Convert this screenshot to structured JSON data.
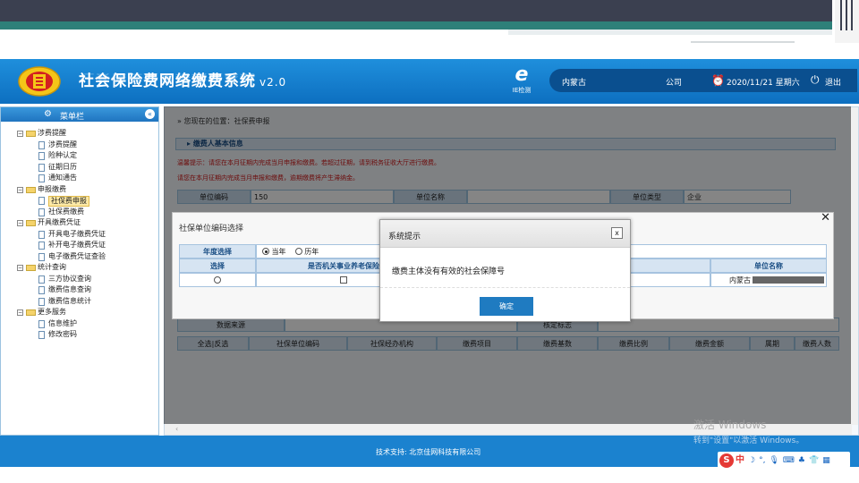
{
  "app": {
    "title": "社会保险费网络缴费系统",
    "version": "v2.0",
    "ie_check_label": "IE检测",
    "region": "内蒙古",
    "company": "公司",
    "datetime": "2020/11/21 星期六",
    "logout": "退出"
  },
  "sidebar": {
    "title": "菜单栏",
    "collapse_glyph": "«",
    "groups": [
      {
        "label": "涉费提醒",
        "items": [
          "涉费提醒",
          "险种认定",
          "征期日历",
          "通知通告"
        ]
      },
      {
        "label": "申报缴费",
        "items": [
          "社保费申报",
          "社保费缴费"
        ]
      },
      {
        "label": "开具缴费凭证",
        "items": [
          "开具电子缴费凭证",
          "补开电子缴费凭证",
          "电子缴费凭证查验"
        ]
      },
      {
        "label": "统计查询",
        "items": [
          "三方协议查询",
          "缴费信息查询",
          "缴费信息统计"
        ]
      },
      {
        "label": "更多服务",
        "items": [
          "信息维护",
          "修改密码"
        ]
      }
    ],
    "active_item": "社保费申报"
  },
  "main": {
    "breadcrumb": "您现在的位置：社保费申报",
    "section_title": "缴费人基本信息",
    "warn1": "温馨提示：请您在本月征期内完成当月申报和缴费。若超过征期，请到税务征收大厅进行缴费。",
    "warn2": "请您在本月征期内完成当月申报和缴费，逾期缴费将产生滞纳金。",
    "form": {
      "unit_code_label": "单位编码",
      "unit_code_value": "150",
      "unit_name_label": "单位名称",
      "unit_type_label": "单位类型",
      "unit_type_value": "企业"
    },
    "lower": {
      "data_source_label": "数据来源",
      "verify_label": "核定标志",
      "columns": [
        "全选|反选",
        "社保单位编码",
        "社保经办机构",
        "缴费项目",
        "缴费基数",
        "缴费比例",
        "缴费金额",
        "属期",
        "缴费人数"
      ]
    }
  },
  "selector_panel": {
    "title": "社保单位编码选择",
    "close_glyph": "✕",
    "year_label": "年度选择",
    "year_current": "当年",
    "year_history": "历年",
    "columns": {
      "select": "选择",
      "is_public": "是否机关事业养老保险",
      "unit_name": "单位名称"
    },
    "row_unit_name": "内蒙古"
  },
  "dialog": {
    "title": "系统提示",
    "close_glyph": "x",
    "message": "缴费主体没有有效的社会保障号",
    "ok": "确定"
  },
  "footer": {
    "support": "技术支持: 北京佳网科技有限公司"
  },
  "os": {
    "watermark_line1": "激活 Windows",
    "watermark_line2": "转到\"设置\"以激活 Windows。",
    "ime_mode": "中"
  },
  "colors": {
    "header_blue": "#0d6fc0",
    "footer_blue": "#1b82cf",
    "ok_button": "#1f7bc1",
    "warning_red": "#d01818"
  }
}
